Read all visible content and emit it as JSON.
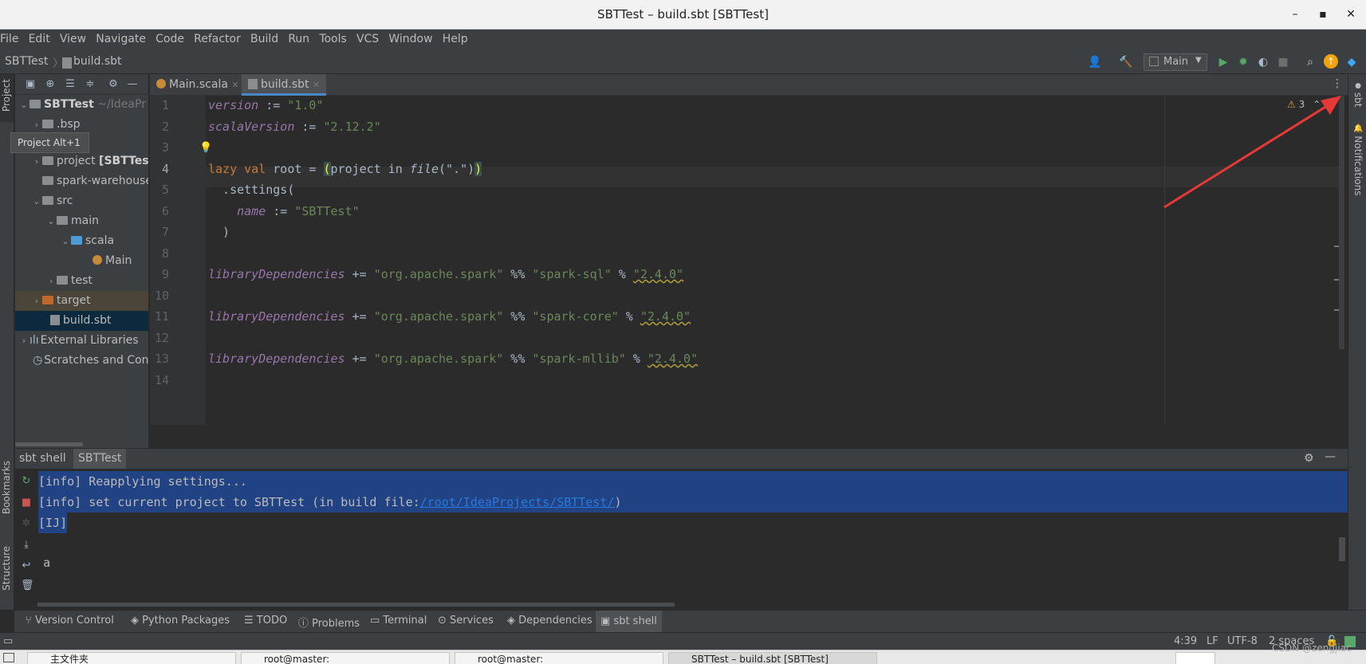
{
  "window": {
    "title": "SBTTest – build.sbt [SBTTest]"
  },
  "menu": [
    "File",
    "Edit",
    "View",
    "Navigate",
    "Code",
    "Refactor",
    "Build",
    "Run",
    "Tools",
    "VCS",
    "Window",
    "Help"
  ],
  "navbar": {
    "project": "SBTTest",
    "file": "build.sbt",
    "run_config": "Main"
  },
  "project_panel": {
    "stripe_label": "Project",
    "tooltip": "Project  Alt+1",
    "tree": [
      {
        "label": "SBTTest",
        "suffix": "~/IdeaPr"
      },
      {
        "label": ".bsp"
      },
      {
        "label": "project",
        "suffix": "[SBTTes"
      },
      {
        "label": "spark-warehouse"
      },
      {
        "label": "src"
      },
      {
        "label": "main"
      },
      {
        "label": "scala"
      },
      {
        "label": "Main"
      },
      {
        "label": "test"
      },
      {
        "label": "target"
      },
      {
        "label": "build.sbt"
      },
      {
        "label": "External Libraries"
      },
      {
        "label": "Scratches and Con"
      }
    ]
  },
  "editor": {
    "tabs": [
      "Main.scala",
      "build.sbt"
    ],
    "active_tab": "build.sbt",
    "inspection_count": "3",
    "line_numbers": [
      "1",
      "2",
      "3",
      "4",
      "5",
      "6",
      "7",
      "8",
      "9",
      "10",
      "11",
      "12",
      "13",
      "14"
    ],
    "lines": {
      "l1_key": "version",
      "l1_op": " := ",
      "l1_val": "\"1.0\"",
      "l2_key": "scalaVersion",
      "l2_op": " := ",
      "l2_val": "\"2.12.2\"",
      "l4_kw1": "lazy",
      "l4_kw2": "val",
      "l4_rest": " root = ",
      "l4_p1": "(",
      "l4_mid": "project in ",
      "l4_fn": "file",
      "l4_arg": "(\".\")",
      "l4_p2": ")",
      "l5": "  .settings(",
      "l6_key": "name",
      "l6_op": " := ",
      "l6_val": "\"SBTTest\"",
      "l7": "  )",
      "dep_key": "libraryDependencies",
      "dep_op": " += ",
      "org": "\"org.apache.spark\"",
      "pct2": " %% ",
      "pct1": " % ",
      "a9": "\"spark-sql\"",
      "v9": "\"2.4.0\"",
      "a11": "\"spark-core\"",
      "v11": "\"2.4.0\"",
      "a13": "\"spark-mllib\"",
      "v13": "\"2.4.0\""
    }
  },
  "right_stripe": {
    "sbt": "sbt",
    "notifications": "Notifications"
  },
  "bottom_panel": {
    "tabs": [
      "sbt shell",
      "SBTTest"
    ],
    "active_tab": "SBTTest",
    "line1": "[info] Reapplying settings...",
    "line2_prefix": "[info] set current project to SBTTest (in build file:",
    "line2_link": "/root/IdeaProjects/SBTTest/",
    "line2_suffix": ")",
    "line3": "[IJ]",
    "prompt_symbol": ">",
    "input": "a",
    "left_labels": [
      "Bookmarks",
      "Structure"
    ]
  },
  "tool_tabs": [
    "Version Control",
    "Python Packages",
    "TODO",
    "Problems",
    "Terminal",
    "Services",
    "Dependencies",
    "sbt shell"
  ],
  "active_tool_tab": "sbt shell",
  "status": {
    "position": "4:39",
    "line_sep": "LF",
    "encoding": "UTF-8",
    "indent": "2 spaces"
  },
  "taskbar": [
    "主文件夹",
    "root@master:",
    "root@master:",
    "SBTTest – build.sbt [SBTTest]"
  ],
  "watermark": "CSDN @zengjiac",
  "colors": {
    "keyword": "#cc7832",
    "string": "#6a8759",
    "identifier": "#9876aa",
    "selection": "#214283",
    "link": "#287bde",
    "annotation_arrow": "#e53935"
  }
}
